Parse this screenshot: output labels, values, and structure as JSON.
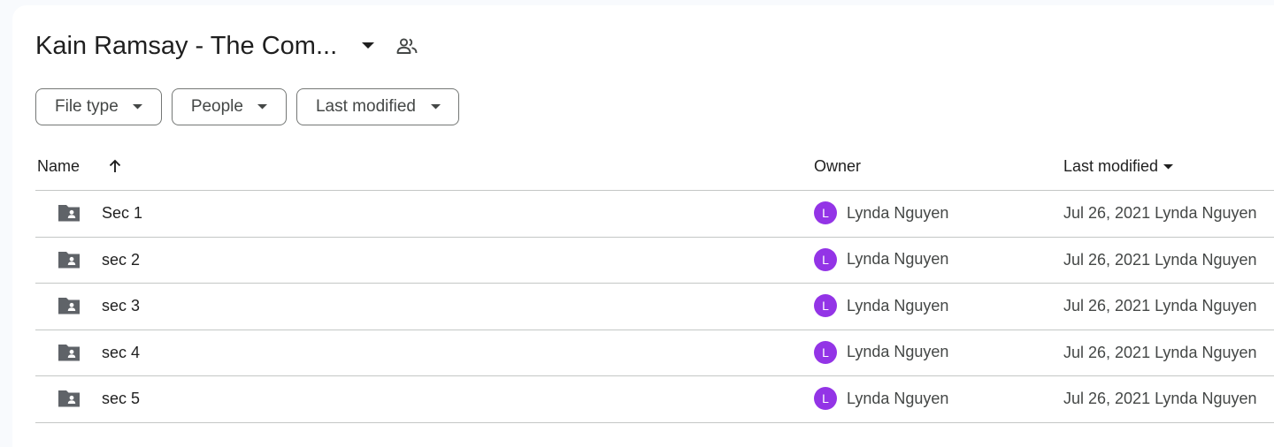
{
  "folder": {
    "title": "Kain Ramsay - The Com..."
  },
  "filters": [
    {
      "label": "File type"
    },
    {
      "label": "People"
    },
    {
      "label": "Last modified"
    }
  ],
  "columns": {
    "name": "Name",
    "owner": "Owner",
    "last_modified": "Last modified"
  },
  "rows": [
    {
      "name": "Sec 1",
      "owner_initial": "L",
      "owner": "Lynda Nguyen",
      "modified": "Jul 26, 2021 Lynda Nguyen"
    },
    {
      "name": "sec 2",
      "owner_initial": "L",
      "owner": "Lynda Nguyen",
      "modified": "Jul 26, 2021 Lynda Nguyen"
    },
    {
      "name": "sec 3",
      "owner_initial": "L",
      "owner": "Lynda Nguyen",
      "modified": "Jul 26, 2021 Lynda Nguyen"
    },
    {
      "name": "sec 4",
      "owner_initial": "L",
      "owner": "Lynda Nguyen",
      "modified": "Jul 26, 2021 Lynda Nguyen"
    },
    {
      "name": "sec 5",
      "owner_initial": "L",
      "owner": "Lynda Nguyen",
      "modified": "Jul 26, 2021 Lynda Nguyen"
    }
  ],
  "icons": {
    "title_dropdown": "caret-down-icon",
    "shared": "people-icon",
    "sort": "arrow-up-icon",
    "folder": "shared-folder-icon"
  },
  "colors": {
    "avatar": "#9334e6",
    "border": "#c4c7c5",
    "chip_border": "#747775",
    "text": "#1f1f1f",
    "secondary_text": "#444746"
  }
}
